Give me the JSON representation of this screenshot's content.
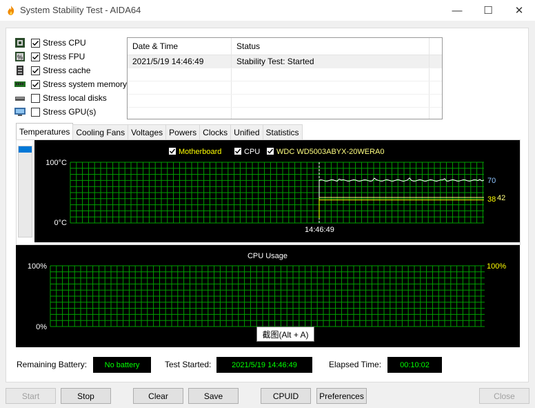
{
  "window": {
    "title": "System Stability Test - AIDA64",
    "minimize": "—",
    "maximize": "☐",
    "close": "✕"
  },
  "stress_options": [
    {
      "label": "Stress CPU",
      "checked": true,
      "icon": "cpu-icon"
    },
    {
      "label": "Stress FPU",
      "checked": true,
      "icon": "fpu-icon"
    },
    {
      "label": "Stress cache",
      "checked": true,
      "icon": "cache-icon"
    },
    {
      "label": "Stress system memory",
      "checked": true,
      "icon": "memory-icon"
    },
    {
      "label": "Stress local disks",
      "checked": false,
      "icon": "disk-icon"
    },
    {
      "label": "Stress GPU(s)",
      "checked": false,
      "icon": "gpu-icon"
    }
  ],
  "log": {
    "headers": [
      "Date & Time",
      "Status"
    ],
    "rows": [
      {
        "time": "2021/5/19 14:46:49",
        "status": "Stability Test: Started"
      }
    ]
  },
  "tabs": [
    "Temperatures",
    "Cooling Fans",
    "Voltages",
    "Powers",
    "Clocks",
    "Unified",
    "Statistics"
  ],
  "active_tab": "Temperatures",
  "temp_graph": {
    "legend": [
      {
        "label": "Motherboard",
        "color": "#ffff00",
        "checked": true
      },
      {
        "label": "CPU",
        "color": "#ffffff",
        "checked": true
      },
      {
        "label": "WDC WD5003ABYX-20WERA0",
        "color": "#ffff80",
        "checked": true
      }
    ],
    "y_max_label": "100°C",
    "y_min_label": "0°C",
    "x_marker_label": "14:46:49",
    "value_cpu": "70",
    "value_mb": "38",
    "value_disk": "42",
    "grid_color": "#00a000"
  },
  "chart_data": [
    {
      "type": "line",
      "title": "",
      "ylim": [
        0,
        100
      ],
      "y_tick_labels": [
        "100°C",
        "0°C"
      ],
      "x_marker": "14:46:49",
      "series": [
        {
          "name": "CPU",
          "current": 70
        },
        {
          "name": "Motherboard",
          "current": 38
        },
        {
          "name": "WDC WD5003ABYX-20WERA0",
          "current": 42
        }
      ]
    },
    {
      "type": "line",
      "title": "CPU Usage",
      "ylim": [
        0,
        100
      ],
      "y_tick_labels": [
        "100%",
        "0%"
      ],
      "series": [
        {
          "current": 100
        }
      ]
    }
  ],
  "usage_graph": {
    "title": "CPU Usage",
    "y_max_label": "100%",
    "y_min_label": "0%",
    "value_label": "100%"
  },
  "tooltip": "截图(Alt + A)",
  "status": {
    "battery_label": "Remaining Battery:",
    "battery_value": "No battery",
    "started_label": "Test Started:",
    "started_value": "2021/5/19 14:46:49",
    "elapsed_label": "Elapsed Time:",
    "elapsed_value": "00:10:02"
  },
  "buttons": {
    "start": "Start",
    "stop": "Stop",
    "clear": "Clear",
    "save": "Save",
    "cpuid": "CPUID",
    "preferences": "Preferences",
    "close": "Close"
  }
}
